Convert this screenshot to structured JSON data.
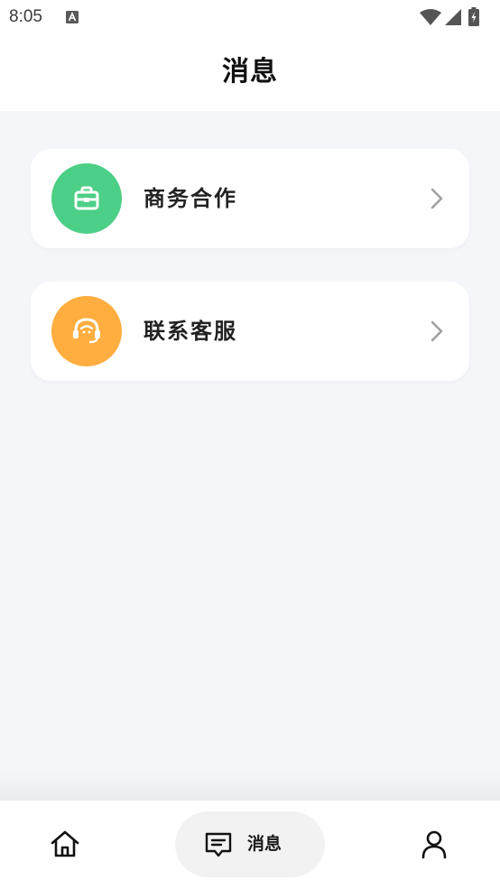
{
  "status_bar": {
    "time": "8:05",
    "icons": [
      "keyboard-a-icon",
      "wifi-icon",
      "cellular-signal-icon",
      "battery-charging-icon"
    ]
  },
  "header": {
    "title": "消息"
  },
  "menu": [
    {
      "label": "商务合作",
      "icon": "briefcase-icon",
      "icon_bg": "#4ccf86"
    },
    {
      "label": "联系客服",
      "icon": "headset-agent-icon",
      "icon_bg": "#ffae3f"
    }
  ],
  "bottom_nav": {
    "items": [
      {
        "icon": "home-icon",
        "label": ""
      },
      {
        "icon": "message-icon",
        "label": "消息",
        "active": true
      },
      {
        "icon": "user-icon",
        "label": ""
      }
    ]
  },
  "colors": {
    "background": "#f5f6fa",
    "card": "#ffffff",
    "active_tab_bg": "#f2f2f2",
    "chevron": "#a0a0a0"
  }
}
